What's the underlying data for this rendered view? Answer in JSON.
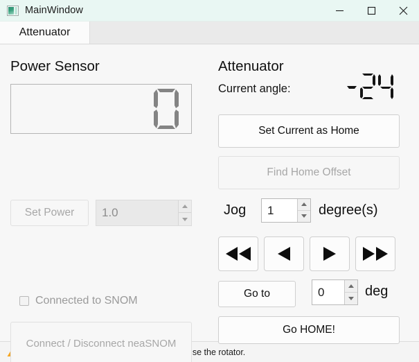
{
  "window": {
    "title": "MainWindow",
    "icon": "app-window-icon",
    "controls": {
      "minimize": "minimize-icon",
      "maximize": "maximize-icon",
      "close": "close-icon"
    }
  },
  "tabs": [
    {
      "label": "Attenuator",
      "active": true
    }
  ],
  "power_sensor": {
    "heading": "Power Sensor",
    "lcd_value": "0",
    "set_power_button": "Set Power",
    "set_power_enabled": false,
    "power_spin_value": "1.0",
    "power_spin_enabled": false,
    "connected_checkbox_label": "Connected to SNOM",
    "connected_checked": false,
    "connect_button": "Connect / Disconnect neaSNOM",
    "connect_enabled": false
  },
  "attenuator": {
    "heading": "Attenuator",
    "current_angle_label": "Current angle:",
    "current_angle_value": "-24",
    "set_home_button": "Set Current as Home",
    "set_home_enabled": true,
    "find_offset_button": "Find Home Offset",
    "find_offset_enabled": false,
    "jog_label": "Jog",
    "jog_value": "1",
    "jog_unit": "degree(s)",
    "nav_buttons": [
      {
        "name": "jog-fast-back",
        "icon": "double-left-arrow-icon"
      },
      {
        "name": "jog-back",
        "icon": "left-arrow-icon"
      },
      {
        "name": "jog-forward",
        "icon": "right-arrow-icon"
      },
      {
        "name": "jog-fast-forward",
        "icon": "double-right-arrow-icon"
      }
    ],
    "goto_button": "Go to",
    "goto_value": "0",
    "goto_unit": "deg",
    "go_home_button": "Go HOME!"
  },
  "status": {
    "icon": "warning-triangle-icon",
    "message": "nea_tools module not found, you can only use the rotator."
  },
  "colors": {
    "titlebar": "#e9f7f3",
    "accent_icon": "#2f8f72",
    "warning": "#f5a623",
    "lcd_light": "#808080",
    "lcd_dark": "#111111"
  }
}
